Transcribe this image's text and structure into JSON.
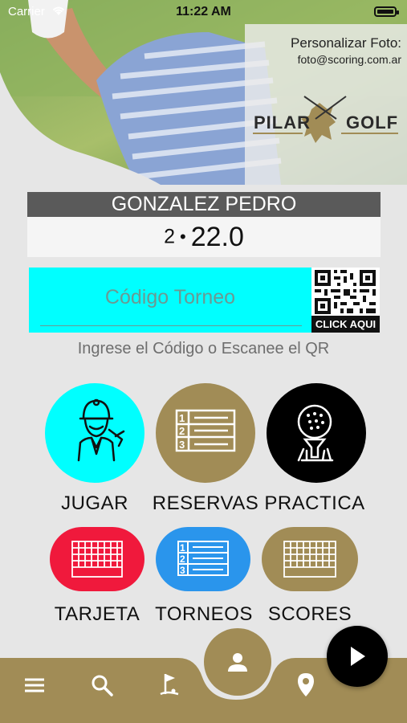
{
  "status_bar": {
    "carrier": "Carrier",
    "time": "11:22 AM"
  },
  "header": {
    "personalize_label": "Personalizar Foto:",
    "personalize_email": "foto@scoring.com.ar",
    "logo_left": "PILAR",
    "logo_right": "GOLF"
  },
  "player": {
    "name": "GONZALEZ PEDRO",
    "number": "2",
    "separator": "•",
    "handicap": "22.0"
  },
  "tournament": {
    "code_placeholder": "Código Torneo",
    "qr_button_label": "CLICK AQUI",
    "hint": "Ingrese el Código o Escanee el QR"
  },
  "buttons": {
    "jugar": "JUGAR",
    "reservas": "RESERVAS",
    "practica": "PRACTICA",
    "tarjeta": "TARJETA",
    "torneos": "TORNEOS",
    "scores": "SCORES"
  },
  "colors": {
    "gold": "#a18c56",
    "cyan": "#00ffff",
    "red": "#f0193c",
    "blue": "#2a95ec",
    "black": "#000000",
    "name_bar": "#5a5a5a"
  },
  "bottom_nav": {
    "icons": [
      "menu-icon",
      "search-icon",
      "golf-hole-icon",
      "profile-icon",
      "location-icon",
      "play-icon"
    ]
  }
}
